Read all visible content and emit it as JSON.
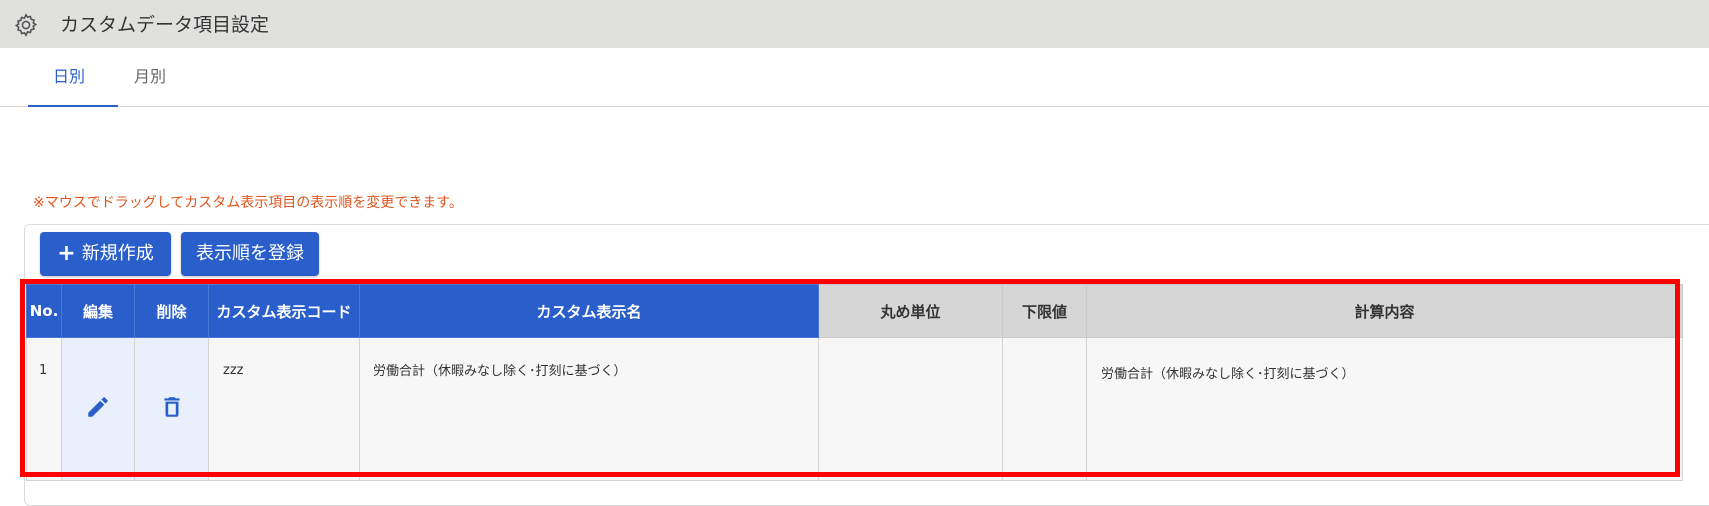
{
  "header": {
    "title": "カスタムデータ項目設定",
    "icon": "gear-icon"
  },
  "tabs": [
    {
      "label": "日別",
      "active": true
    },
    {
      "label": "月別",
      "active": false
    }
  ],
  "notice": "※マウスでドラッグしてカスタム表示項目の表示順を変更できます。",
  "toolbar": {
    "new_label": "新規作成",
    "order_label": "表示順を登録"
  },
  "table": {
    "columns": [
      "No.",
      "編集",
      "削除",
      "カスタム表示コード",
      "カスタム表示名",
      "丸め単位",
      "下限値",
      "計算内容"
    ],
    "rows": [
      {
        "no": "1",
        "code": "zzz",
        "name": "労働合計（休暇みなし除く･打刻に基づく）",
        "rounding": "",
        "lower_limit": "",
        "calc": "労働合計（休暇みなし除く･打刻に基づく）"
      }
    ]
  },
  "colors": {
    "accent": "#2a5fcb",
    "notice": "#e0541c",
    "highlight": "#ff0000"
  }
}
